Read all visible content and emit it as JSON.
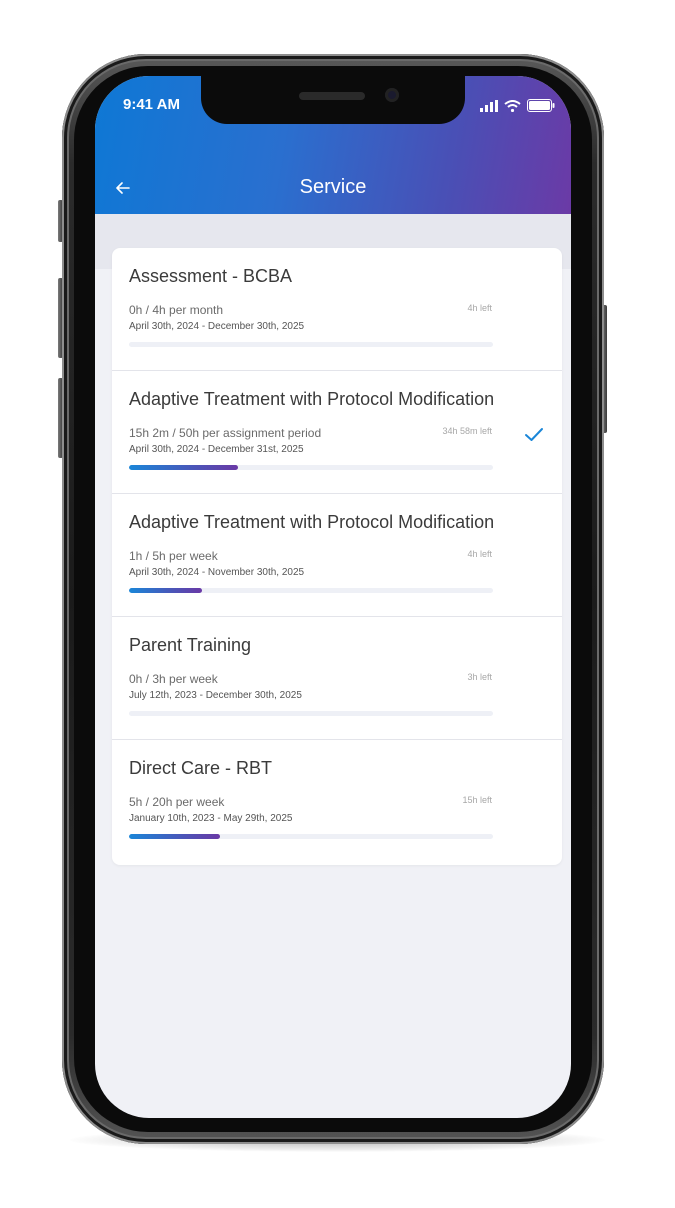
{
  "status_bar": {
    "time": "9:41 AM"
  },
  "header": {
    "title": "Service"
  },
  "services": [
    {
      "name": "Assessment - BCBA",
      "usage": "0h / 4h per month",
      "dates": "April 30th, 2024 - December 30th, 2025",
      "left": "4h left",
      "progress": 0.0,
      "selected": false
    },
    {
      "name": "Adaptive Treatment with Protocol Modification",
      "usage": "15h 2m / 50h per assignment period",
      "dates": "April 30th, 2024 - December 31st, 2025",
      "left": "34h 58m left",
      "progress": 0.3,
      "selected": true
    },
    {
      "name": "Adaptive Treatment with Protocol Modification",
      "usage": "1h / 5h per week",
      "dates": "April 30th, 2024 - November 30th, 2025",
      "left": "4h left",
      "progress": 0.2,
      "selected": false
    },
    {
      "name": "Parent Training",
      "usage": "0h / 3h per week",
      "dates": "July 12th, 2023 - December 30th, 2025",
      "left": "3h left",
      "progress": 0.0,
      "selected": false
    },
    {
      "name": "Direct Care - RBT",
      "usage": "5h / 20h per week",
      "dates": "January 10th, 2023 - May 29th, 2025",
      "left": "15h left",
      "progress": 0.25,
      "selected": false
    }
  ],
  "colors": {
    "header_gradient_start": "#0e78d5",
    "header_gradient_end": "#6b3aa6",
    "check": "#1a86d8"
  },
  "icons": {
    "back": "arrow-left-icon",
    "check": "checkmark-icon",
    "signal": "signal-icon",
    "wifi": "wifi-icon",
    "battery": "battery-icon"
  }
}
